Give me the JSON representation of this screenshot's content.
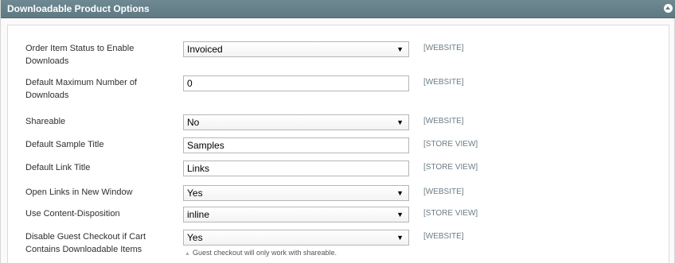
{
  "panel": {
    "title": "Downloadable Product Options"
  },
  "rows": [
    {
      "label": "Order Item Status to Enable Downloads",
      "type": "select",
      "value": "Invoiced",
      "scope": "[WEBSITE]"
    },
    {
      "label": "Default Maximum Number of Downloads",
      "type": "text",
      "value": "0",
      "scope": "[WEBSITE]"
    },
    {
      "label": "Shareable",
      "type": "select",
      "value": "No",
      "scope": "[WEBSITE]"
    },
    {
      "label": "Default Sample Title",
      "type": "text",
      "value": "Samples",
      "scope": "[STORE VIEW]"
    },
    {
      "label": "Default Link Title",
      "type": "text",
      "value": "Links",
      "scope": "[STORE VIEW]"
    },
    {
      "label": "Open Links in New Window",
      "type": "select",
      "value": "Yes",
      "scope": "[WEBSITE]"
    },
    {
      "label": "Use Content-Disposition",
      "type": "select",
      "value": "inline",
      "scope": "[STORE VIEW]"
    },
    {
      "label": "Disable Guest Checkout if Cart Contains Downloadable Items",
      "type": "select",
      "value": "Yes",
      "scope": "[WEBSITE]",
      "note": "Guest checkout will only work with shareable."
    }
  ],
  "icons": {
    "dropdown": "▼",
    "collapse": "collapse-up-icon",
    "note": "▲"
  }
}
